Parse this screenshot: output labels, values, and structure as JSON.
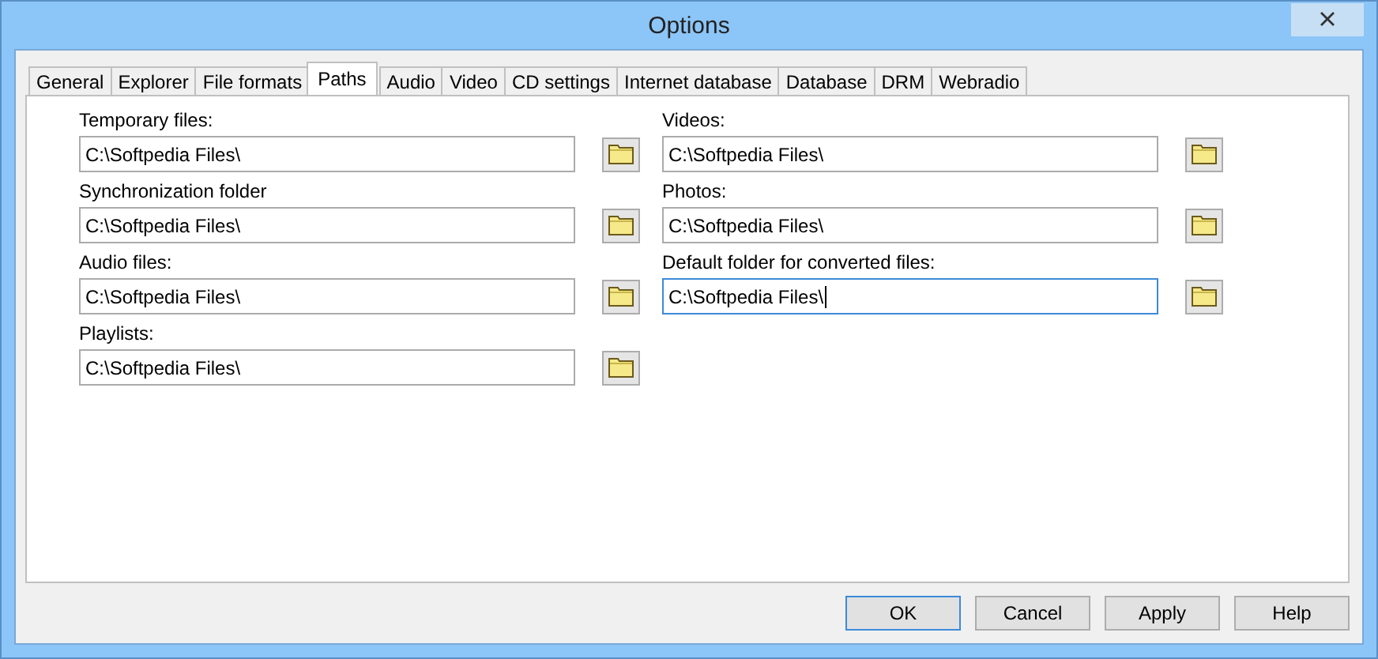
{
  "window": {
    "title": "Options"
  },
  "tabs": [
    {
      "label": "General",
      "selected": false
    },
    {
      "label": "Explorer",
      "selected": false
    },
    {
      "label": "File formats",
      "selected": false
    },
    {
      "label": "Paths",
      "selected": true
    },
    {
      "label": "Audio",
      "selected": false
    },
    {
      "label": "Video",
      "selected": false
    },
    {
      "label": "CD settings",
      "selected": false
    },
    {
      "label": "Internet database",
      "selected": false
    },
    {
      "label": "Database",
      "selected": false
    },
    {
      "label": "DRM",
      "selected": false
    },
    {
      "label": "Webradio",
      "selected": false
    }
  ],
  "left_fields": [
    {
      "label": "Temporary files:",
      "value": "C:\\Softpedia Files\\",
      "focused": false
    },
    {
      "label": "Synchronization folder",
      "value": "C:\\Softpedia Files\\",
      "focused": false
    },
    {
      "label": "Audio files:",
      "value": "C:\\Softpedia Files\\",
      "focused": false
    },
    {
      "label": "Playlists:",
      "value": "C:\\Softpedia Files\\",
      "focused": false
    }
  ],
  "right_fields": [
    {
      "label": "Videos:",
      "value": "C:\\Softpedia Files\\",
      "focused": false
    },
    {
      "label": "Photos:",
      "value": "C:\\Softpedia Files\\",
      "focused": false
    },
    {
      "label": "Default folder for converted files:",
      "value": "C:\\Softpedia Files\\",
      "focused": true
    }
  ],
  "buttons": [
    {
      "label": "OK",
      "default": true
    },
    {
      "label": "Cancel",
      "default": false
    },
    {
      "label": "Apply",
      "default": false
    },
    {
      "label": "Help",
      "default": false
    }
  ]
}
